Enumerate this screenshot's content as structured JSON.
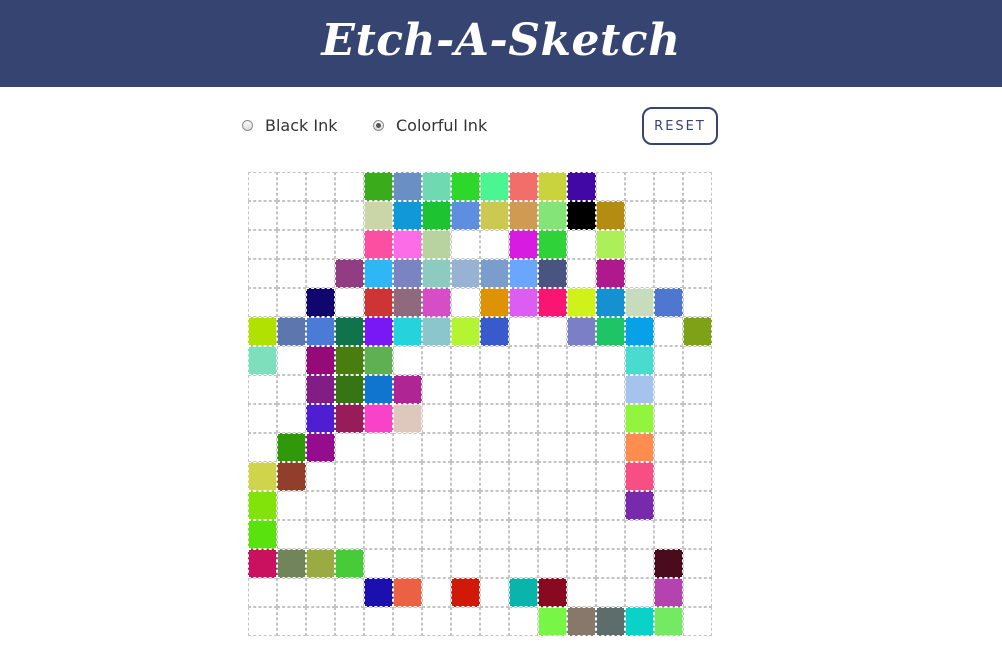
{
  "header": {
    "title": "Etch-A-Sketch"
  },
  "controls": {
    "black_label": "Black Ink",
    "color_label": "Colorful Ink",
    "selected": "color",
    "reset_label": "RESET"
  },
  "colors": {
    "header_bg": "#364471",
    "accent": "#364471"
  },
  "grid": {
    "rows": 16,
    "cols": 16,
    "cells": [
      [
        "",
        "",
        "",
        "",
        "#3aab1b",
        "#6a8fc4",
        "#6fdab2",
        "#2ed82a",
        "#4af592",
        "#f16e6a",
        "#c9d33c",
        "#4108a6",
        "",
        "",
        "",
        ""
      ],
      [
        "",
        "",
        "",
        "",
        "#cbd6a8",
        "#0f99d9",
        "#1ec331",
        "#5e8ee0",
        "#cbc952",
        "#d09a52",
        "#84e475",
        "#000000",
        "#b38c11",
        "",
        "",
        ""
      ],
      [
        "",
        "",
        "",
        "",
        "#fc4fa1",
        "#fc6ce7",
        "#b9d3a0",
        "",
        "",
        "#d81be1",
        "#2fd339",
        "",
        "#acef58",
        "",
        "",
        ""
      ],
      [
        "",
        "",
        "",
        "#913c83",
        "#2fb6f4",
        "#7b84c3",
        "#8dcbc1",
        "#98b2d3",
        "#7b9dcb",
        "#6aa6fa",
        "#4a5480",
        "",
        "#b0198d",
        "",
        "",
        ""
      ],
      [
        "",
        "",
        "#10066d",
        "",
        "#cd3434",
        "#906a7c",
        "#d54ec5",
        "",
        "#de9307",
        "#db5df1",
        "#fb1572",
        "#d1f11a",
        "#1690cf",
        "#c7dcbc",
        "#4f77cf",
        ""
      ],
      [
        "#b0e102",
        "#5c77ae",
        "#4a7bd6",
        "#10734b",
        "#7917f5",
        "#25d3dd",
        "#8bc6cc",
        "#b5f432",
        "#385acd",
        "",
        "",
        "#7a7fc6",
        "#1fc467",
        "#07a1e8",
        "",
        "#7ea117"
      ],
      [
        "#7ddfbb",
        "",
        "#940a79",
        "#4a7d0f",
        "#5fb053",
        "",
        "",
        "",
        "",
        "",
        "",
        "",
        "",
        "#49dbce",
        "",
        ""
      ],
      [
        "",
        "",
        "#811d84",
        "#367414",
        "#1075ce",
        "#ae2593",
        "",
        "",
        "",
        "",
        "",
        "",
        "",
        "#a5c3ec",
        "",
        ""
      ],
      [
        "",
        "",
        "#4f1ed3",
        "#971c59",
        "#f843c9",
        "#dec8bd",
        "",
        "",
        "",
        "",
        "",
        "",
        "",
        "#90f53c",
        "",
        ""
      ],
      [
        "",
        "#30990a",
        "#950c8f",
        "",
        "",
        "",
        "",
        "",
        "",
        "",
        "",
        "",
        "",
        "#fe8d4f",
        "",
        ""
      ],
      [
        "#cfd44a",
        "#913e2c",
        "",
        "",
        "",
        "",
        "",
        "",
        "",
        "",
        "",
        "",
        "",
        "#f74e86",
        "",
        ""
      ],
      [
        "#82e30b",
        "",
        "",
        "",
        "",
        "",
        "",
        "",
        "",
        "",
        "",
        "",
        "",
        "#772bac",
        "",
        ""
      ],
      [
        "#5ae20e",
        "",
        "",
        "",
        "",
        "",
        "",
        "",
        "",
        "",
        "",
        "",
        "",
        "",
        "",
        ""
      ],
      [
        "#c91160",
        "#71845a",
        "#9aab43",
        "#47cb38",
        "",
        "",
        "",
        "",
        "",
        "",
        "",
        "",
        "",
        "",
        "#4a0b1f",
        ""
      ],
      [
        "",
        "",
        "",
        "",
        "#1b0fae",
        "#ea6243",
        "",
        "#d11909",
        "",
        "#09b4aa",
        "#880920",
        "",
        "",
        "",
        "#b443af",
        ""
      ],
      [
        "",
        "",
        "",
        "",
        "",
        "",
        "",
        "",
        "",
        "",
        "#77f646",
        "#88786b",
        "#5c6d6c",
        "#0bd2c8",
        "#73ea62",
        ""
      ]
    ]
  }
}
